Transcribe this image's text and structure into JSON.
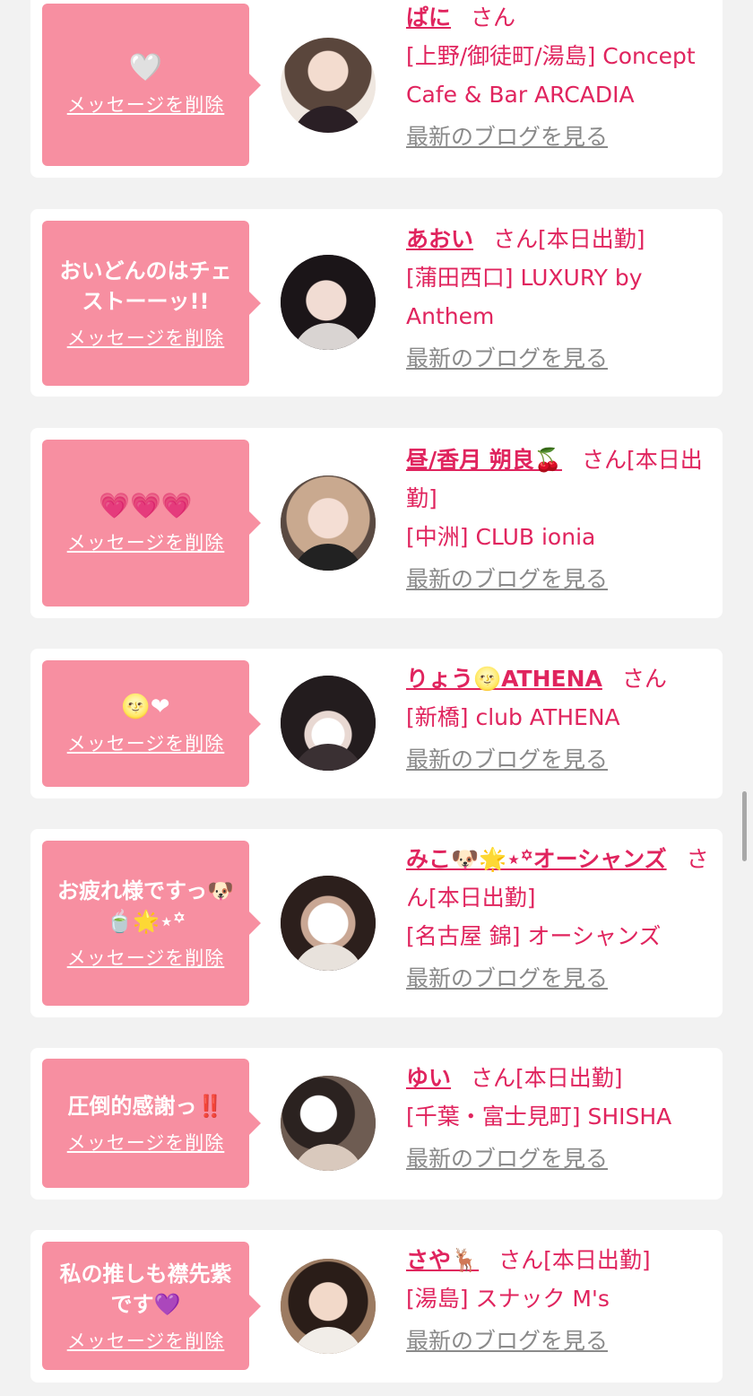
{
  "delete_label": "メッセージを削除",
  "san_label": "さん",
  "blog_label": "最新のブログを見る",
  "colors": {
    "accent": "#e0245e",
    "bubble": "#f78fa1",
    "background": "#f2f2f2"
  },
  "cards": [
    {
      "message": "🤍",
      "name": "ぱに",
      "status": "",
      "shop": "[上野/御徒町/湯島] Concept Cafe & Bar ARCADIA"
    },
    {
      "message": "おいどんのはチェストーーッ!!",
      "name": "あおい",
      "status": "[本日出勤]",
      "shop": "[蒲田西口] LUXURY by Anthem"
    },
    {
      "message": "💗💗💗",
      "name": "昼/香月 朔良🍒",
      "status": "[本日出勤]",
      "shop": "[中洲] CLUB ionia"
    },
    {
      "message": "🌝❤",
      "name": "りょう🌝ATHENA",
      "status": "",
      "shop": "[新橋] club ATHENA"
    },
    {
      "message": "お疲れ様ですっ🐶🍵🌟⋆꙳",
      "name": "みこ🐶🌟⋆꙳オーシャンズ",
      "status": "[本日出勤]",
      "shop": "[名古屋 錦] オーシャンズ"
    },
    {
      "message": "圧倒的感謝っ‼️",
      "name": "ゆい",
      "status": "[本日出勤]",
      "shop": "[千葉・富士見町] SHISHA"
    },
    {
      "message": "私の推しも襟先紫です💜",
      "name": "さや🦌",
      "status": "[本日出勤]",
      "shop": "[湯島] スナック M's"
    }
  ]
}
